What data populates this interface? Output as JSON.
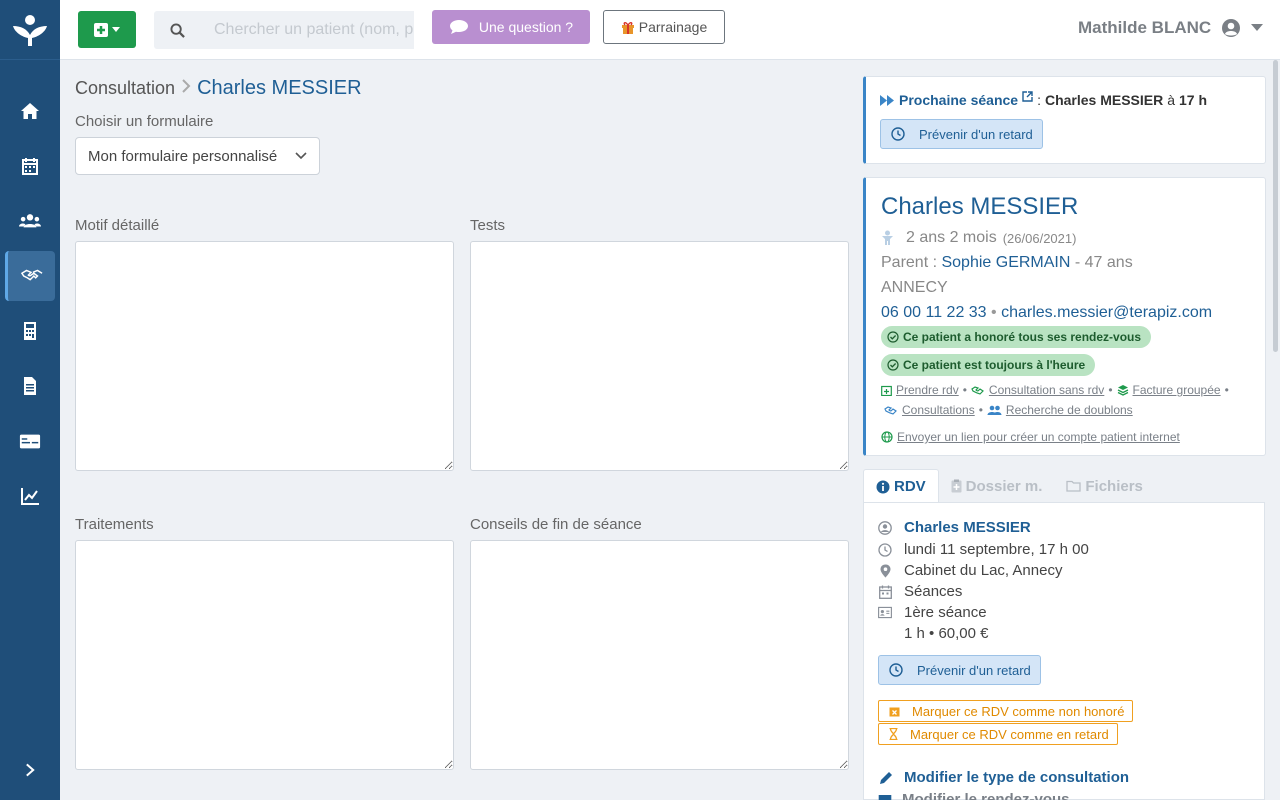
{
  "colors": {
    "sidebar": "#1f4e79",
    "brand_blue": "#1f5f95",
    "add_button": "#1e9a4c",
    "question_button": "#b98fd0",
    "success_pill": "#b9e3c2",
    "warning": "#f0a020"
  },
  "sidebar": {
    "items": [
      {
        "name": "home",
        "icon": "home-icon"
      },
      {
        "name": "calendar",
        "icon": "calendar-icon"
      },
      {
        "name": "patients",
        "icon": "users-icon"
      },
      {
        "name": "consultations",
        "icon": "handshake-icon",
        "active": true
      },
      {
        "name": "accounting",
        "icon": "calculator-icon"
      },
      {
        "name": "documents",
        "icon": "file-icon"
      },
      {
        "name": "payments",
        "icon": "card-icon"
      },
      {
        "name": "stats",
        "icon": "chart-icon"
      }
    ],
    "collapse_icon": "chevron-right-icon"
  },
  "topbar": {
    "search_placeholder": "Chercher un patient (nom, p",
    "question_label": "Une question ?",
    "parrainage_label": "Parrainage",
    "user_name": "Mathilde BLANC"
  },
  "main": {
    "breadcrumb_root": "Consultation",
    "breadcrumb_current": "Charles MESSIER",
    "form_choice_label": "Choisir un formulaire",
    "form_choice_value": "Mon formulaire personnalisé",
    "fields": {
      "motif": "Motif détaillé",
      "tests": "Tests",
      "traitements": "Traitements",
      "conseils": "Conseils de fin de séance"
    }
  },
  "next_session": {
    "label": "Prochaine séance",
    "colon": ":",
    "patient": "Charles MESSIER",
    "at": "à",
    "time": "17 h",
    "late_button": "Prévenir d'un retard"
  },
  "patient": {
    "name": "Charles MESSIER",
    "age": "2 ans 2 mois",
    "birthdate": "(26/06/2021)",
    "parent_label": "Parent :",
    "parent_name": "Sophie GERMAIN",
    "parent_age": "- 47 ans",
    "city": "ANNECY",
    "phone": "06 00 11 22 33",
    "email": "charles.messier@terapiz.com",
    "badge_honored": "Ce patient a honoré tous ses rendez-vous",
    "badge_ontime": "Ce patient est toujours à l'heure",
    "links": {
      "book": "Prendre rdv",
      "consult_no_rdv": "Consultation sans rdv",
      "grouped_invoice": "Facture groupée",
      "consultations": "Consultations",
      "duplicates": "Recherche de doublons",
      "send_link": "Envoyer un lien pour créer un compte patient internet"
    }
  },
  "tabs": [
    {
      "label": "RDV",
      "icon": "info-icon",
      "active": true
    },
    {
      "label": "Dossier m.",
      "icon": "clipboard-icon",
      "active": false
    },
    {
      "label": "Fichiers",
      "icon": "folder-icon",
      "active": false
    }
  ],
  "rdv": {
    "patient": "Charles MESSIER",
    "datetime": "lundi 11 septembre, 17 h 00",
    "location": "Cabinet du Lac, Annecy",
    "type": "Séances",
    "session": "1ère séance",
    "duration_price": "1 h • 60,00 €",
    "late_button": "Prévenir d'un retard",
    "mark_no_show": "Marquer ce RDV comme non honoré",
    "mark_late": "Marquer ce RDV comme en retard",
    "modify_type": "Modifier le type de consultation",
    "modify_rdv": "Modifier le rendez-vous"
  }
}
